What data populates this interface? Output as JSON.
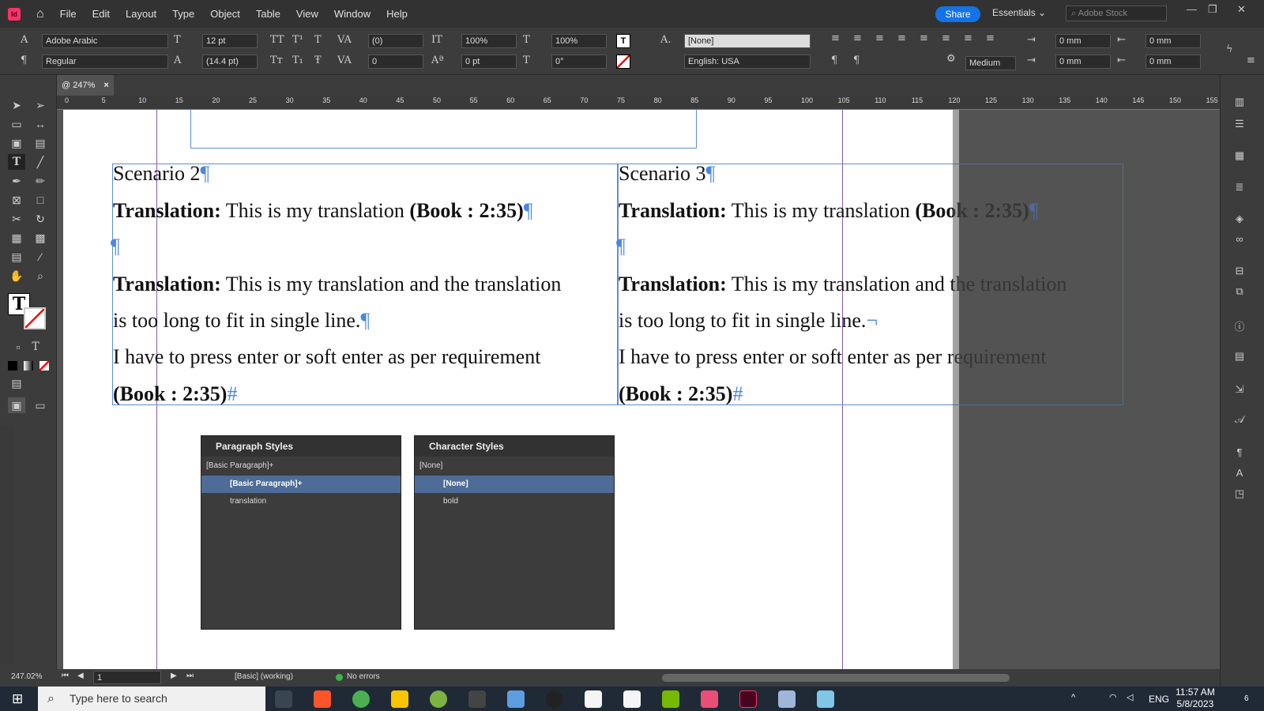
{
  "app": {
    "logo": "Id",
    "share": "Share",
    "workspace": "Essentials",
    "stock_placeholder": "Adobe Stock"
  },
  "menu": [
    "File",
    "Edit",
    "Layout",
    "Type",
    "Object",
    "Table",
    "View",
    "Window",
    "Help"
  ],
  "control": {
    "font_family": "Adobe Arabic",
    "font_style": "Regular",
    "font_size": "12 pt",
    "leading": "(14.4 pt)",
    "kerning": "(0)",
    "tracking": "0",
    "vscale": "100%",
    "baseline": "0 pt",
    "hscale": "100%",
    "skew": "0°",
    "char_style": "[None]",
    "language": "English: USA",
    "hyph": "Medium",
    "indent_l": "0 mm",
    "indent_r": "0 mm",
    "space_b": "0 mm",
    "space_a": "0 mm",
    "space_b2": "0 mm",
    "space_a2": "0 mm"
  },
  "doc_tab": {
    "label": "@ 247%",
    "close": "×"
  },
  "ruler_ticks": [
    "0",
    "5",
    "10",
    "15",
    "20",
    "25",
    "30",
    "35",
    "40",
    "45",
    "50",
    "55",
    "60",
    "65",
    "70",
    "75",
    "80",
    "85",
    "90",
    "95",
    "100",
    "105",
    "110",
    "115",
    "120",
    "125",
    "130",
    "135",
    "140",
    "145",
    "150",
    "155"
  ],
  "scenario2": {
    "heading": "Scenario 2",
    "t1_bold": "Translation:",
    "t1_text": " This is my translation ",
    "t1_ref": "(Book : 2:35)",
    "t2_bold": "Translation:",
    "t2_text": " This is my translation and the translation",
    "t2_line2": "is too long to fit in single line.",
    "t3": "I have to press enter or soft enter as per requirement",
    "ref": "(Book : 2:35)"
  },
  "scenario3": {
    "heading": "Scenario 3",
    "t1_bold": "Translation:",
    "t1_text": " This is my translation ",
    "t1_ref": "(Book : 2:35)",
    "t2_bold": "Translation:",
    "t2_text": " This is my translation and the translation",
    "t2_line2": "is too long to fit in single line.",
    "t3": "I have to press enter or soft enter as per requirement",
    "ref": "(Book : 2:35)"
  },
  "para_panel": {
    "title": "Paragraph Styles",
    "current": "[Basic Paragraph]+",
    "items": [
      "[Basic Paragraph]+",
      "translation"
    ]
  },
  "char_panel": {
    "title": "Character Styles",
    "current": "[None]",
    "items": [
      "[None]",
      "bold"
    ]
  },
  "status": {
    "zoom": "247.02%",
    "page": "1",
    "preflight_profile": "[Basic] (working)",
    "errors": "No errors"
  },
  "taskbar": {
    "search_placeholder": "Type here to search",
    "lang": "ENG",
    "time": "11:57 AM",
    "date": "5/8/2023",
    "notif": "6"
  },
  "colors": {
    "brand": "#ff3366",
    "share": "#1473e6",
    "frame": "#5b8fd6",
    "guide": "#8a5bb0",
    "selected_row": "#4d6c97"
  }
}
